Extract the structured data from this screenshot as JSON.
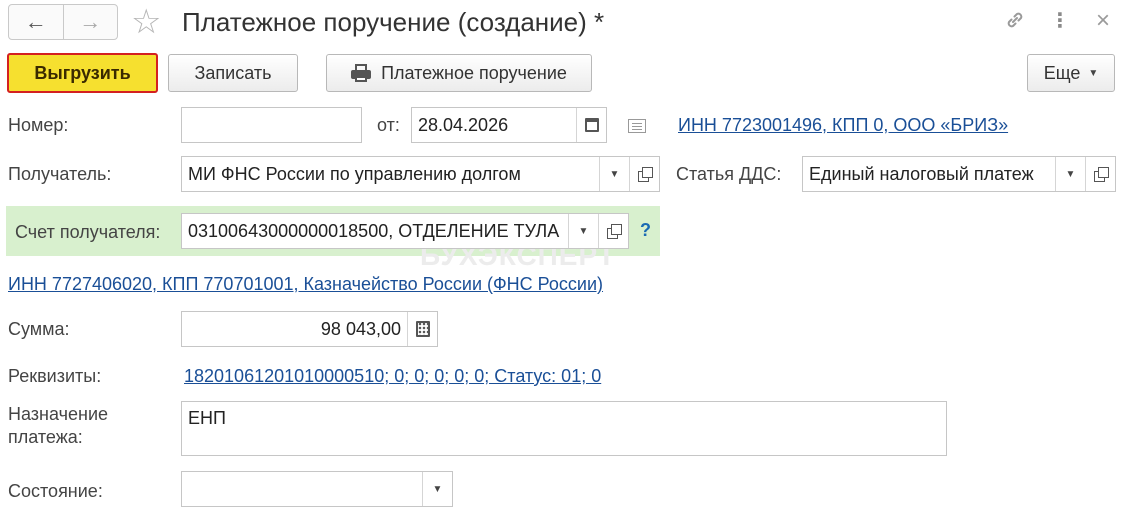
{
  "window": {
    "title": "Платежное поручение (создание) *",
    "back_icon": "←",
    "forward_icon": "→",
    "star_icon": "☆",
    "link_icon": "🔗",
    "more_icon": "⋮",
    "close_icon": "×"
  },
  "toolbar": {
    "upload_label": "Выгрузить",
    "save_label": "Записать",
    "print_label": "Платежное поручение",
    "more_label": "Еще"
  },
  "form": {
    "number_label": "Номер:",
    "number_value": "",
    "date_label": "от:",
    "date_value": "28.04.2026",
    "org_link": "ИНН 7723001496, КПП 0, ООО «БРИЗ»",
    "recipient_label": "Получатель:",
    "recipient_value": "МИ ФНС России по управлению долгом",
    "dds_label": "Статья ДДС:",
    "dds_value": "Единый налоговый платеж",
    "account_label": "Счет получателя:",
    "account_value": "03100643000000018500, ОТДЕЛЕНИЕ ТУЛА",
    "help_mark": "?",
    "recipient_link": "ИНН 7727406020, КПП 770701001, Казначейство России (ФНС России)",
    "sum_label": "Сумма:",
    "sum_value": "98 043,00",
    "requisites_label": "Реквизиты:",
    "requisites_link": "18201061201010000510; 0; 0; 0; 0; 0; Статус: 01; 0",
    "purpose_label_1": "Назначение",
    "purpose_label_2": "платежа:",
    "purpose_value": "ЕНП",
    "state_label": "Состояние:",
    "state_value": ""
  },
  "watermark": "БУХЭКСПЕРТ"
}
